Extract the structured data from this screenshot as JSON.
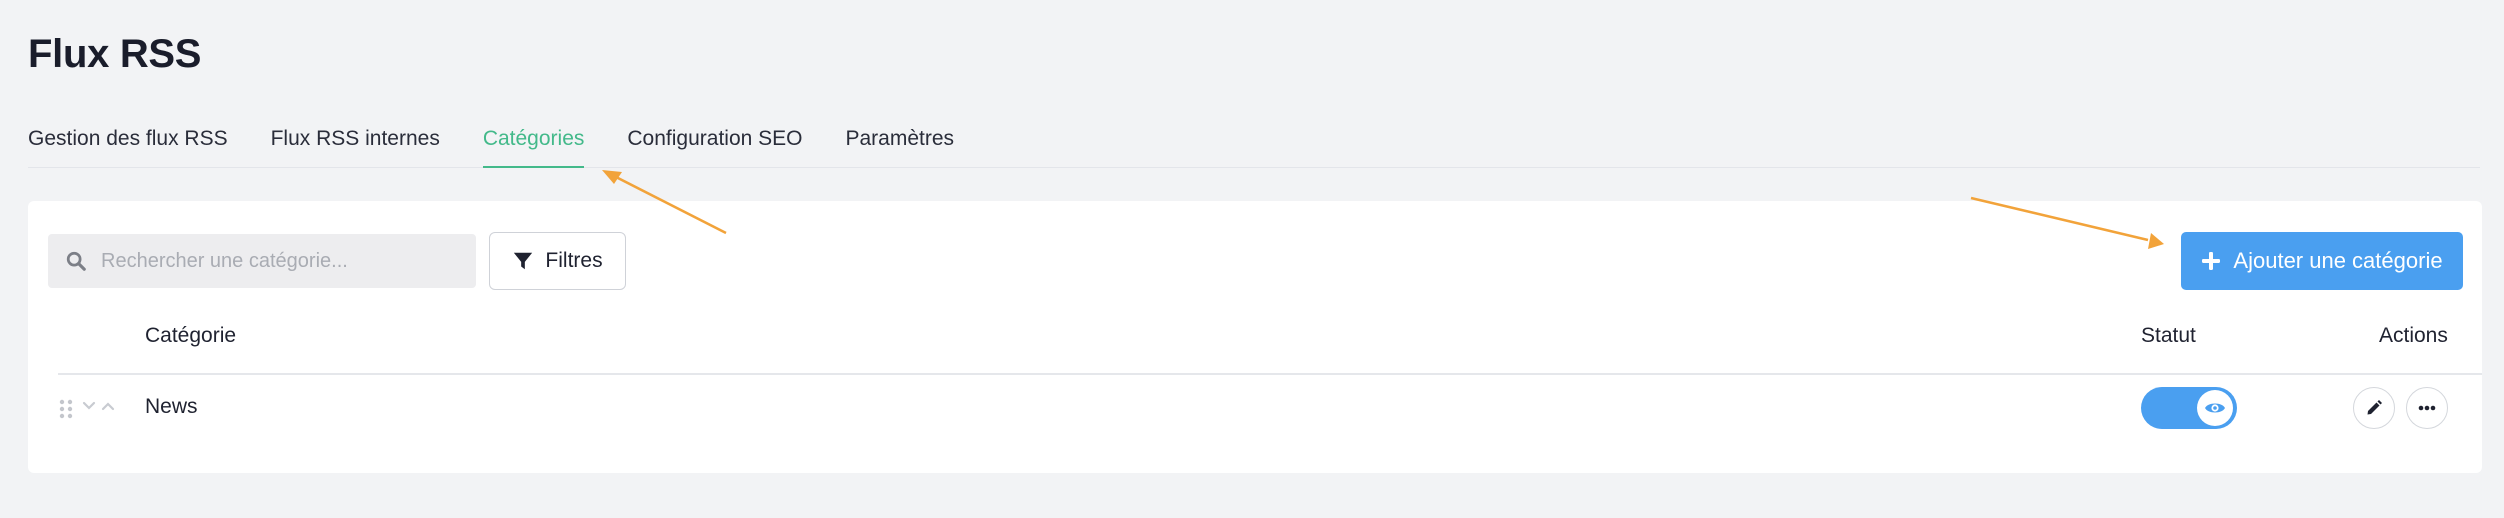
{
  "page": {
    "title": "Flux RSS"
  },
  "tabs": [
    {
      "label": "Gestion des flux RSS",
      "active": false
    },
    {
      "label": "Flux RSS internes",
      "active": false
    },
    {
      "label": "Catégories",
      "active": true
    },
    {
      "label": "Configuration SEO",
      "active": false
    },
    {
      "label": "Paramètres",
      "active": false
    }
  ],
  "toolbar": {
    "search_placeholder": "Rechercher une catégorie...",
    "search_icon": "search-icon",
    "filter_label": "Filtres",
    "filter_icon": "funnel-icon",
    "add_label": "Ajouter une catégorie",
    "add_icon": "plus-icon"
  },
  "table": {
    "headers": {
      "category": "Catégorie",
      "status": "Statut",
      "actions": "Actions"
    },
    "rows": [
      {
        "name": "News",
        "status_on": true,
        "status_icon": "eye-icon",
        "actions": [
          "pencil-icon",
          "more-icon"
        ]
      }
    ]
  },
  "colors": {
    "accent_green": "#43b98a",
    "primary_blue": "#4a9ff0",
    "annotation_orange": "#f2a33a",
    "background": "#f2f3f5"
  }
}
